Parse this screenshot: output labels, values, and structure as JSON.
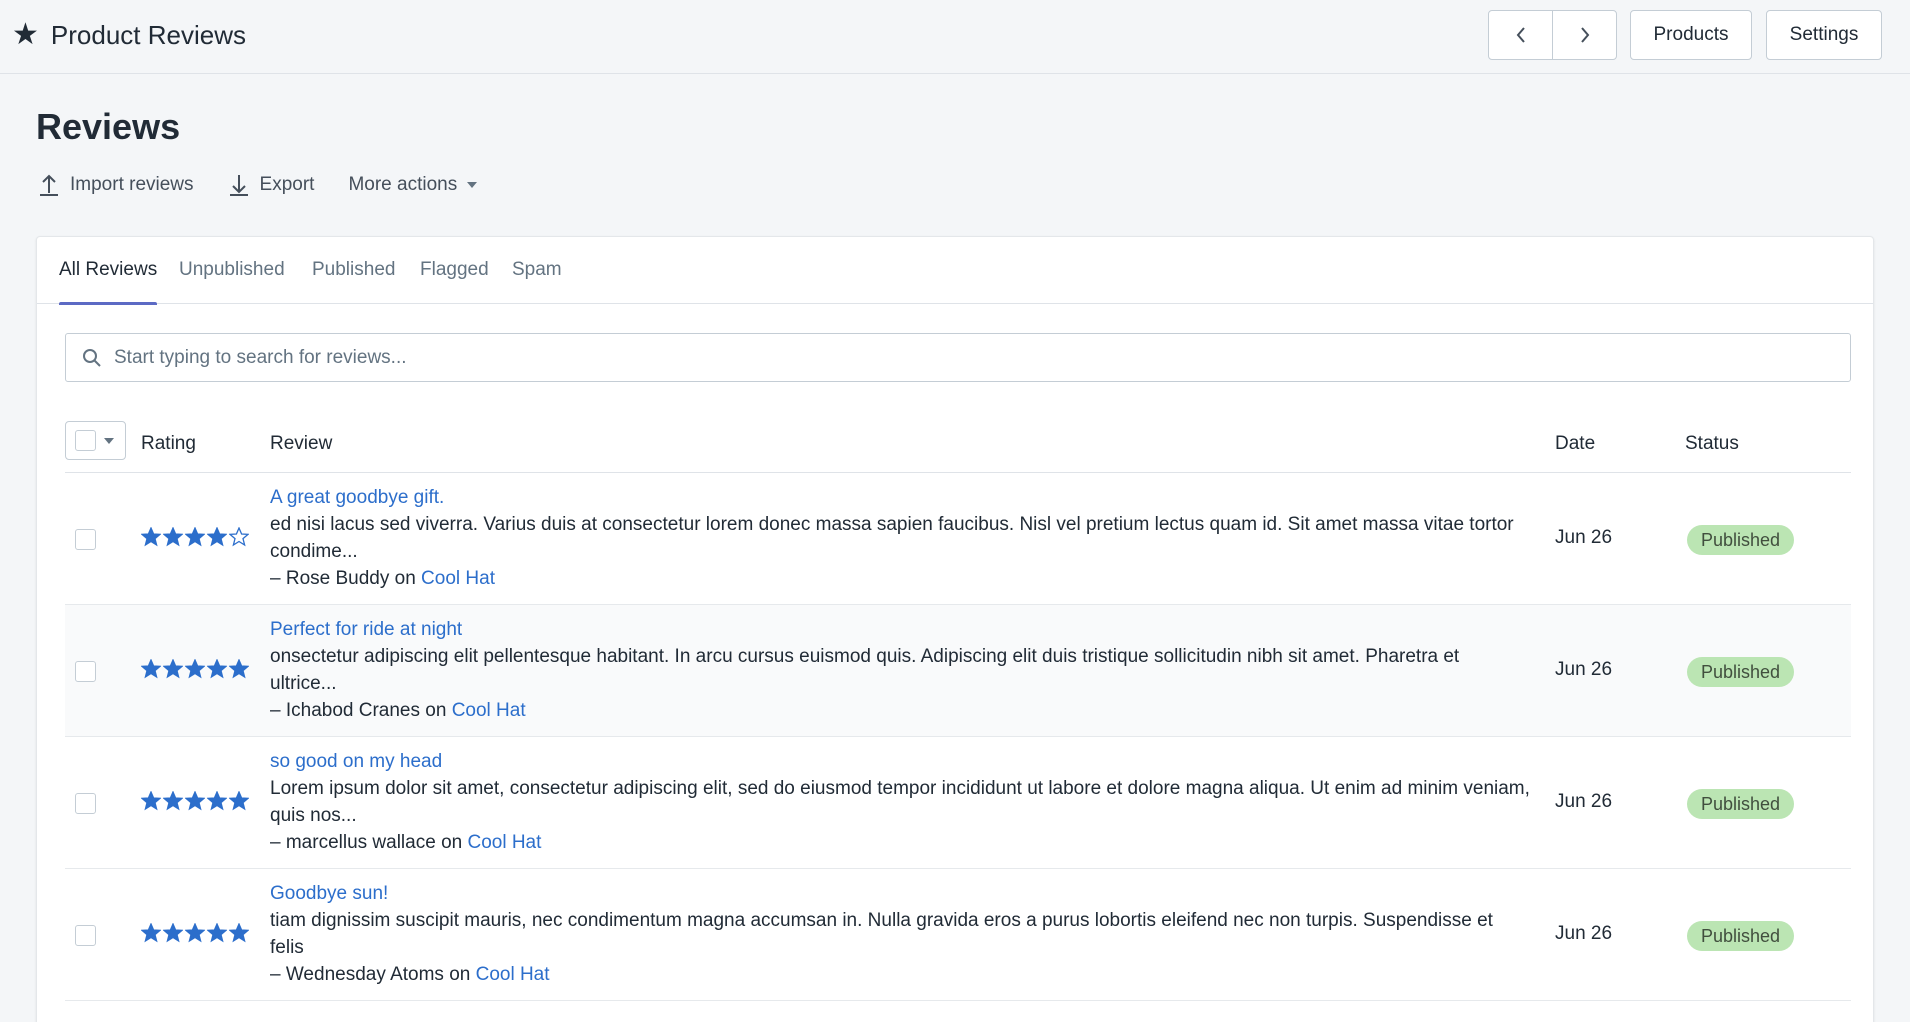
{
  "app": {
    "title": "Product Reviews",
    "icon": "star-icon"
  },
  "topbar": {
    "prev_icon": "chevron-left-icon",
    "next_icon": "chevron-right-icon",
    "products_label": "Products",
    "settings_label": "Settings"
  },
  "page": {
    "title": "Reviews"
  },
  "actions": {
    "import_label": "Import reviews",
    "export_label": "Export",
    "more_label": "More actions"
  },
  "tabs": [
    "All Reviews",
    "Unpublished",
    "Published",
    "Flagged",
    "Spam"
  ],
  "active_tab": "All Reviews",
  "search": {
    "placeholder": "Start typing to search for reviews..."
  },
  "table": {
    "headers": {
      "rating": "Rating",
      "review": "Review",
      "date": "Date",
      "status": "Status"
    },
    "rows": [
      {
        "rating": 4,
        "title": "A great goodbye gift.",
        "body": "ed nisi lacus sed viverra. Varius duis at consectetur lorem donec massa sapien faucibus. Nisl vel pretium lectus quam id. Sit amet massa vitae tortor condime...",
        "author_prefix": "– Rose Buddy on",
        "product": "Cool Hat",
        "date": "Jun 26",
        "status": "Published"
      },
      {
        "rating": 5,
        "title": "Perfect for ride at night",
        "body": "onsectetur adipiscing elit pellentesque habitant. In arcu cursus euismod quis. Adipiscing elit duis tristique sollicitudin nibh sit amet. Pharetra et ultrice...",
        "author_prefix": "– Ichabod Cranes on",
        "product": "Cool Hat",
        "date": "Jun 26",
        "status": "Published"
      },
      {
        "rating": 5,
        "title": "so good on my head",
        "body": "Lorem ipsum dolor sit amet, consectetur adipiscing elit, sed do eiusmod tempor incididunt ut labore et dolore magna aliqua. Ut enim ad minim veniam, quis nos...",
        "author_prefix": "– marcellus wallace on",
        "product": "Cool Hat",
        "date": "Jun 26",
        "status": "Published"
      },
      {
        "rating": 5,
        "title": "Goodbye sun!",
        "body": "tiam dignissim suscipit mauris, nec condimentum magna accumsan in. Nulla gravida eros a purus lobortis eleifend nec non turpis. Suspendisse et felis",
        "author_prefix": "– Wednesday Atoms on",
        "product": "Cool Hat",
        "date": "Jun 26",
        "status": "Published"
      }
    ]
  },
  "colors": {
    "accent": "#5c6ac4",
    "link": "#2c6ecb",
    "star": "#2c6ecb",
    "badge_bg": "#bbe5b3",
    "badge_text": "#414f3e"
  }
}
